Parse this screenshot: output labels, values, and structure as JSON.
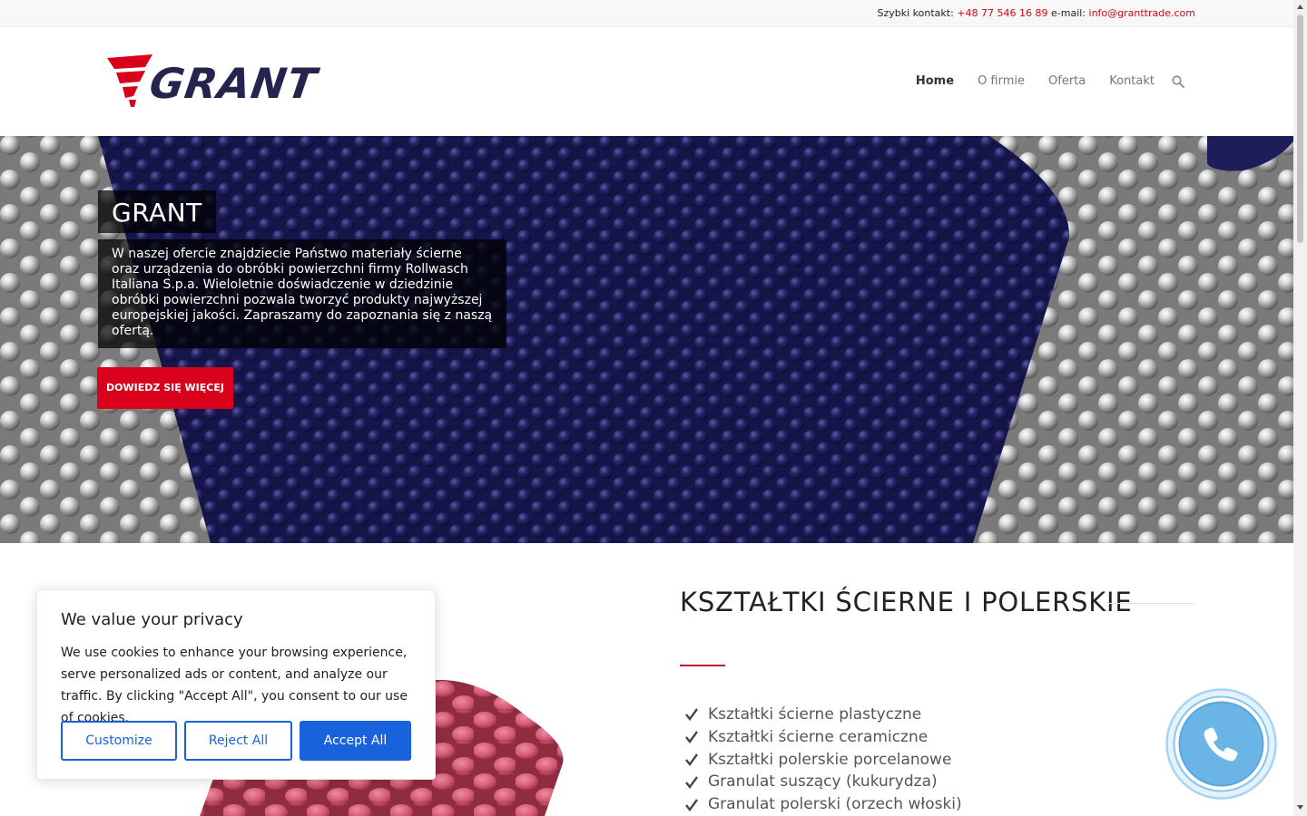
{
  "topbar": {
    "label": "Szybki kontakt:",
    "phone": "+48 77 546 16 89",
    "email_label": "e-mail:",
    "email": "info@granttrade.com"
  },
  "header": {
    "logo_text": "GRANT",
    "nav": [
      "Home",
      "O firmie",
      "Oferta",
      "Kontakt"
    ],
    "active_item": "Home"
  },
  "hero": {
    "title": "GRANT",
    "text": "W naszej ofercie znajdziecie Państwo materiały ścierne oraz urządzenia do obróbki powierzchni firmy Rollwasch Italiana S.p.a. Wieloletnie doświadczenie w dziedzinie obróbki powierzchni pozwala tworzyć produkty najwyższej europejskiej jakości. Zapraszamy do zapoznania się z naszą ofertą.",
    "button": "DOWIEDZ SIĘ WIĘCEJ"
  },
  "section": {
    "title": "KSZTAŁTKI ŚCIERNE I POLERSKIE",
    "items": [
      "Kształtki ścierne plastyczne",
      "Kształtki ścierne ceramiczne",
      "Kształtki polerskie porcelanowe",
      "Granulat suszący (kukurydza)",
      "Granulat polerski (orzech włoski)"
    ]
  },
  "cookie": {
    "title": "We value your privacy",
    "text": "We use cookies to enhance your browsing experience, serve personalized ads or content, and analyze our traffic. By clicking \"Accept All\", you consent to our use of cookies.",
    "customize": "Customize",
    "reject": "Reject All",
    "accept": "Accept All"
  },
  "colors": {
    "brand_red": "#d8001b",
    "brand_navy": "#24244f",
    "cookie_blue": "#1863dc",
    "phone_blue": "#6ab4e6"
  },
  "icons": [
    "search-icon",
    "check-icon",
    "phone-icon",
    "logo-icon"
  ]
}
